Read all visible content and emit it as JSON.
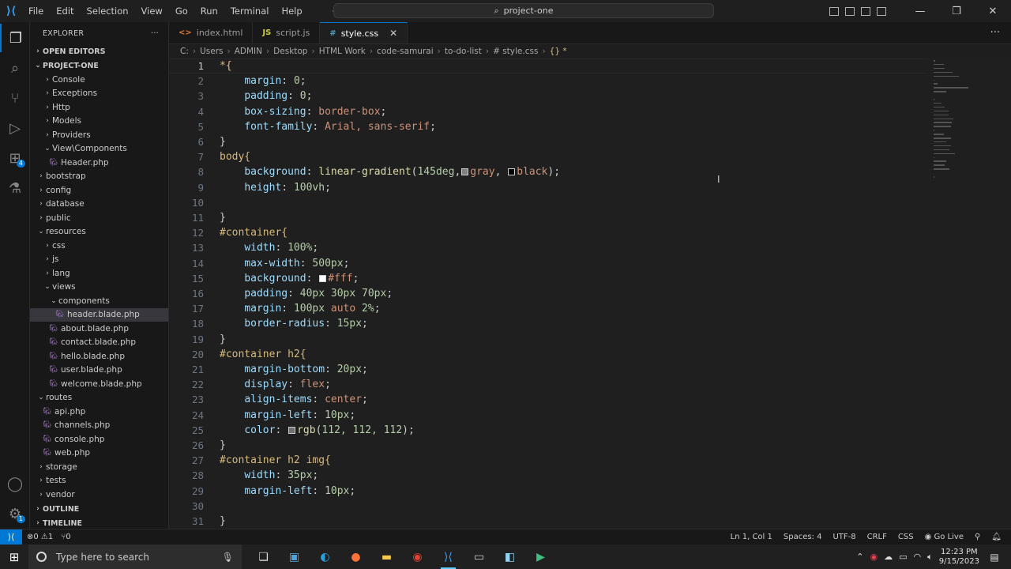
{
  "window": {
    "menu": [
      "File",
      "Edit",
      "Selection",
      "View",
      "Go",
      "Run",
      "Terminal",
      "Help"
    ],
    "search_text": "project-one"
  },
  "explorer": {
    "title": "EXPLORER",
    "open_editors": "OPEN EDITORS",
    "project": "PROJECT-ONE",
    "items": [
      {
        "label": "Console",
        "depth": 1,
        "kind": "folder",
        "open": false
      },
      {
        "label": "Exceptions",
        "depth": 1,
        "kind": "folder",
        "open": false
      },
      {
        "label": "Http",
        "depth": 1,
        "kind": "folder",
        "open": false
      },
      {
        "label": "Models",
        "depth": 1,
        "kind": "folder",
        "open": false
      },
      {
        "label": "Providers",
        "depth": 1,
        "kind": "folder",
        "open": false
      },
      {
        "label": "View\\Components",
        "depth": 1,
        "kind": "folder",
        "open": true
      },
      {
        "label": "Header.php",
        "depth": 2,
        "kind": "php"
      },
      {
        "label": "bootstrap",
        "depth": 0,
        "kind": "folder",
        "open": false
      },
      {
        "label": "config",
        "depth": 0,
        "kind": "folder",
        "open": false
      },
      {
        "label": "database",
        "depth": 0,
        "kind": "folder",
        "open": false
      },
      {
        "label": "public",
        "depth": 0,
        "kind": "folder",
        "open": false
      },
      {
        "label": "resources",
        "depth": 0,
        "kind": "folder",
        "open": true
      },
      {
        "label": "css",
        "depth": 1,
        "kind": "folder",
        "open": false
      },
      {
        "label": "js",
        "depth": 1,
        "kind": "folder",
        "open": false
      },
      {
        "label": "lang",
        "depth": 1,
        "kind": "folder",
        "open": false
      },
      {
        "label": "views",
        "depth": 1,
        "kind": "folder",
        "open": true
      },
      {
        "label": "components",
        "depth": 2,
        "kind": "folder",
        "open": true
      },
      {
        "label": "header.blade.php",
        "depth": 3,
        "kind": "php",
        "selected": true
      },
      {
        "label": "about.blade.php",
        "depth": 2,
        "kind": "php"
      },
      {
        "label": "contact.blade.php",
        "depth": 2,
        "kind": "php"
      },
      {
        "label": "hello.blade.php",
        "depth": 2,
        "kind": "php"
      },
      {
        "label": "user.blade.php",
        "depth": 2,
        "kind": "php"
      },
      {
        "label": "welcome.blade.php",
        "depth": 2,
        "kind": "php"
      },
      {
        "label": "routes",
        "depth": 0,
        "kind": "folder",
        "open": true
      },
      {
        "label": "api.php",
        "depth": 1,
        "kind": "php"
      },
      {
        "label": "channels.php",
        "depth": 1,
        "kind": "php"
      },
      {
        "label": "console.php",
        "depth": 1,
        "kind": "php"
      },
      {
        "label": "web.php",
        "depth": 1,
        "kind": "php"
      },
      {
        "label": "storage",
        "depth": 0,
        "kind": "folder",
        "open": false
      },
      {
        "label": "tests",
        "depth": 0,
        "kind": "folder",
        "open": false
      },
      {
        "label": "vendor",
        "depth": 0,
        "kind": "folder",
        "open": false
      }
    ],
    "outline": "OUTLINE",
    "timeline": "TIMELINE"
  },
  "activity_badges": {
    "extensions": "4",
    "settings": "1"
  },
  "tabs": [
    {
      "label": "index.html",
      "icon": "<>",
      "icon_color": "#e37933",
      "active": false
    },
    {
      "label": "script.js",
      "icon": "JS",
      "icon_color": "#cbcb41",
      "active": false
    },
    {
      "label": "style.css",
      "icon": "#",
      "icon_color": "#519aba",
      "active": true
    }
  ],
  "breadcrumbs": [
    "C:",
    "Users",
    "ADMIN",
    "Desktop",
    "HTML Work",
    "code-samurai",
    "to-do-list",
    "# style.css",
    "{} *"
  ],
  "code_lines": [
    [
      [
        "sel",
        "*{"
      ]
    ],
    [
      [
        "pun",
        "    "
      ],
      [
        "prop",
        "margin"
      ],
      [
        "pun",
        ": "
      ],
      [
        "num",
        "0"
      ],
      [
        "pun",
        ";"
      ]
    ],
    [
      [
        "pun",
        "    "
      ],
      [
        "prop",
        "padding"
      ],
      [
        "pun",
        ": "
      ],
      [
        "num",
        "0"
      ],
      [
        "pun",
        ";"
      ]
    ],
    [
      [
        "pun",
        "    "
      ],
      [
        "prop",
        "box-sizing"
      ],
      [
        "pun",
        ": "
      ],
      [
        "val",
        "border-box"
      ],
      [
        "pun",
        ";"
      ]
    ],
    [
      [
        "pun",
        "    "
      ],
      [
        "prop",
        "font-family"
      ],
      [
        "pun",
        ": "
      ],
      [
        "val",
        "Arial, sans-serif"
      ],
      [
        "pun",
        ";"
      ]
    ],
    [
      [
        "pun",
        "}"
      ]
    ],
    [
      [
        "sel",
        "body{"
      ]
    ],
    [
      [
        "pun",
        "    "
      ],
      [
        "prop",
        "background"
      ],
      [
        "pun",
        ": "
      ],
      [
        "fn",
        "linear-gradient"
      ],
      [
        "pun",
        "("
      ],
      [
        "num",
        "145deg"
      ],
      [
        "pun",
        ","
      ],
      [
        "sw",
        "#808080"
      ],
      [
        "val",
        "gray"
      ],
      [
        "pun",
        ", "
      ],
      [
        "sw",
        "#000000"
      ],
      [
        "val",
        "black"
      ],
      [
        "pun",
        ");"
      ]
    ],
    [
      [
        "pun",
        "    "
      ],
      [
        "prop",
        "height"
      ],
      [
        "pun",
        ": "
      ],
      [
        "num",
        "100vh"
      ],
      [
        "pun",
        ";"
      ]
    ],
    [],
    [
      [
        "pun",
        "}"
      ]
    ],
    [
      [
        "sel",
        "#container{"
      ]
    ],
    [
      [
        "pun",
        "    "
      ],
      [
        "prop",
        "width"
      ],
      [
        "pun",
        ": "
      ],
      [
        "num",
        "100%"
      ],
      [
        "pun",
        ";"
      ]
    ],
    [
      [
        "pun",
        "    "
      ],
      [
        "prop",
        "max-width"
      ],
      [
        "pun",
        ": "
      ],
      [
        "num",
        "500px"
      ],
      [
        "pun",
        ";"
      ]
    ],
    [
      [
        "pun",
        "    "
      ],
      [
        "prop",
        "background"
      ],
      [
        "pun",
        ": "
      ],
      [
        "sw",
        "#ffffff"
      ],
      [
        "val",
        "#fff"
      ],
      [
        "pun",
        ";"
      ]
    ],
    [
      [
        "pun",
        "    "
      ],
      [
        "prop",
        "padding"
      ],
      [
        "pun",
        ": "
      ],
      [
        "num",
        "40px 30px 70px"
      ],
      [
        "pun",
        ";"
      ]
    ],
    [
      [
        "pun",
        "    "
      ],
      [
        "prop",
        "margin"
      ],
      [
        "pun",
        ": "
      ],
      [
        "num",
        "100px"
      ],
      [
        "val",
        " auto "
      ],
      [
        "num",
        "2%"
      ],
      [
        "pun",
        ";"
      ]
    ],
    [
      [
        "pun",
        "    "
      ],
      [
        "prop",
        "border-radius"
      ],
      [
        "pun",
        ": "
      ],
      [
        "num",
        "15px"
      ],
      [
        "pun",
        ";"
      ]
    ],
    [
      [
        "pun",
        "}"
      ]
    ],
    [
      [
        "sel",
        "#container h2{"
      ]
    ],
    [
      [
        "pun",
        "    "
      ],
      [
        "prop",
        "margin-bottom"
      ],
      [
        "pun",
        ": "
      ],
      [
        "num",
        "20px"
      ],
      [
        "pun",
        ";"
      ]
    ],
    [
      [
        "pun",
        "    "
      ],
      [
        "prop",
        "display"
      ],
      [
        "pun",
        ": "
      ],
      [
        "val",
        "flex"
      ],
      [
        "pun",
        ";"
      ]
    ],
    [
      [
        "pun",
        "    "
      ],
      [
        "prop",
        "align-items"
      ],
      [
        "pun",
        ": "
      ],
      [
        "val",
        "center"
      ],
      [
        "pun",
        ";"
      ]
    ],
    [
      [
        "pun",
        "    "
      ],
      [
        "prop",
        "margin-left"
      ],
      [
        "pun",
        ": "
      ],
      [
        "num",
        "10px"
      ],
      [
        "pun",
        ";"
      ]
    ],
    [
      [
        "pun",
        "    "
      ],
      [
        "prop",
        "color"
      ],
      [
        "pun",
        ": "
      ],
      [
        "sw",
        "#707070"
      ],
      [
        "fn",
        "rgb"
      ],
      [
        "pun",
        "("
      ],
      [
        "num",
        "112, 112, 112"
      ],
      [
        "pun",
        ");"
      ]
    ],
    [
      [
        "pun",
        "}"
      ]
    ],
    [
      [
        "sel",
        "#container h2 img{"
      ]
    ],
    [
      [
        "pun",
        "    "
      ],
      [
        "prop",
        "width"
      ],
      [
        "pun",
        ": "
      ],
      [
        "num",
        "35px"
      ],
      [
        "pun",
        ";"
      ]
    ],
    [
      [
        "pun",
        "    "
      ],
      [
        "prop",
        "margin-left"
      ],
      [
        "pun",
        ": "
      ],
      [
        "num",
        "10px"
      ],
      [
        "pun",
        ";"
      ]
    ],
    [],
    [
      [
        "pun",
        "}"
      ]
    ]
  ],
  "status": {
    "errors": "⊗0 ⚠1",
    "ports": "⑂0",
    "position": "Ln 1, Col 1",
    "spaces": "Spaces: 4",
    "encoding": "UTF-8",
    "eol": "CRLF",
    "language": "CSS",
    "golive": "Go Live"
  },
  "taskbar": {
    "search_placeholder": "Type here to search",
    "time": "12:23 PM",
    "date": "9/15/2023"
  }
}
